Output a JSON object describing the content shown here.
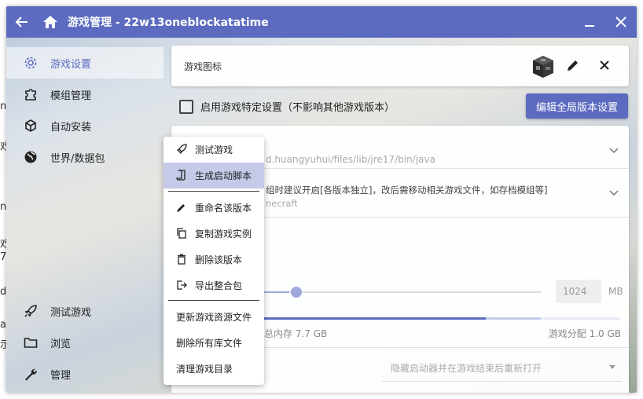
{
  "window": {
    "title": "游戏管理 - 22w13oneblockatatime"
  },
  "background_fragments": [
    "ne",
    "戏",
    "ne",
    "戏",
    "7",
    "d",
    "a",
    "示"
  ],
  "sidebar": {
    "top_items": [
      {
        "label": "游戏设置",
        "icon": "gear-icon",
        "active": true
      },
      {
        "label": "模组管理",
        "icon": "puzzle-icon",
        "active": false
      },
      {
        "label": "自动安装",
        "icon": "cube-icon",
        "active": false
      },
      {
        "label": "世界/数据包",
        "icon": "globe-icon",
        "active": false
      }
    ],
    "bottom_items": [
      {
        "label": "测试游戏",
        "icon": "rocket-icon"
      },
      {
        "label": "浏览",
        "icon": "folder-icon"
      },
      {
        "label": "管理",
        "icon": "wrench-icon"
      }
    ]
  },
  "icon_card": {
    "label": "游戏图标"
  },
  "specific_settings": {
    "checkbox_label": "启用游戏特定设置（不影响其他游戏版本）",
    "checked": false
  },
  "global_button": {
    "label": "编辑全局版本设置"
  },
  "settings": {
    "java_path": "d.huangyuhui/files/lib/jre17/bin/java",
    "game_dir_hint": "组时建议开启[各版本独立]，改后需移动相关游戏文件，如存档模组等]",
    "game_dir_value": "necraft",
    "memory_value": "1024",
    "memory_unit": "MB",
    "memory_total": "总内存 7.7 GB",
    "memory_allocated": "游戏分配 1.0 GB",
    "launcher_visibility": "隐藏启动器并在游戏结束后重新打开"
  },
  "popup_menu": {
    "group1": [
      {
        "label": "测试游戏",
        "icon": "rocket-icon",
        "highlighted": false
      },
      {
        "label": "生成启动脚本",
        "icon": "script-icon",
        "highlighted": true
      }
    ],
    "group2": [
      {
        "label": "重命名该版本",
        "icon": "pencil-icon"
      },
      {
        "label": "复制游戏实例",
        "icon": "copy-icon"
      },
      {
        "label": "删除该版本",
        "icon": "trash-icon"
      },
      {
        "label": "导出整合包",
        "icon": "export-icon"
      }
    ],
    "group3": [
      {
        "label": "更新游戏资源文件"
      },
      {
        "label": "删除所有库文件"
      },
      {
        "label": "清理游戏目录"
      }
    ]
  },
  "colors": {
    "accent": "#5c6bc0",
    "highlight": "#c5cae9"
  }
}
